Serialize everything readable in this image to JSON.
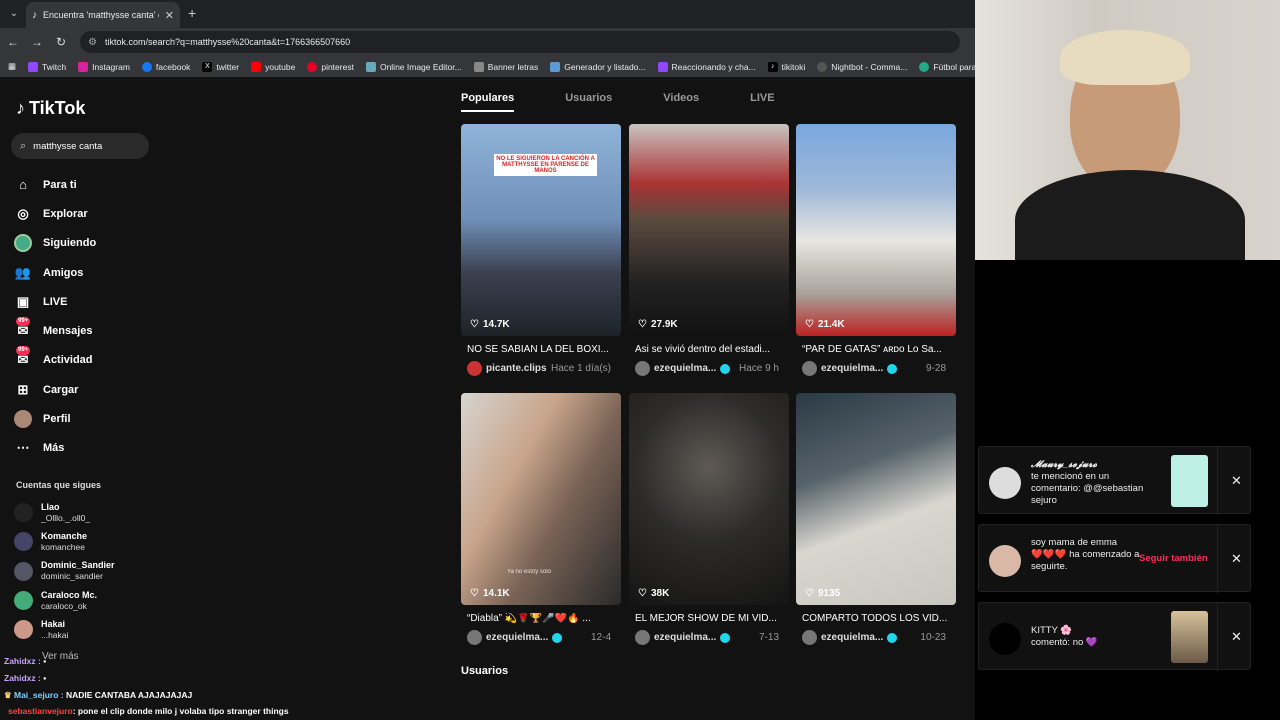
{
  "browser": {
    "tab_title": "Encuentra 'matthysse canta' en",
    "url": "tiktok.com/search?q=matthysse%20canta&t=1766366507660",
    "bookmarks": [
      "Twitch",
      "Instagram",
      "facebook",
      "twitter",
      "youtube",
      "pinterest",
      "Online Image Editor...",
      "Banner letras",
      "Generador y listado...",
      "Reaccionando y cha...",
      "tikitoki",
      "Nightbot - Comma...",
      "Fútbol para Todos"
    ]
  },
  "sidebar": {
    "logo": "TikTok",
    "search_value": "matthysse canta",
    "menu": [
      {
        "label": "Para ti",
        "icon": "home-icon"
      },
      {
        "label": "Explorar",
        "icon": "compass-icon"
      },
      {
        "label": "Siguiendo",
        "icon": "following-icon"
      },
      {
        "label": "Amigos",
        "icon": "friends-icon"
      },
      {
        "label": "LIVE",
        "icon": "live-icon"
      },
      {
        "label": "Mensajes",
        "icon": "messages-icon",
        "badge": "99+"
      },
      {
        "label": "Actividad",
        "icon": "activity-icon",
        "badge": "99+"
      },
      {
        "label": "Cargar",
        "icon": "upload-icon"
      },
      {
        "label": "Perfil",
        "icon": "profile-icon"
      },
      {
        "label": "Más",
        "icon": "more-icon"
      }
    ],
    "following_title": "Cuentas que sigues",
    "following": [
      {
        "name": "Llao",
        "handle": "_Olllo._.oll0_"
      },
      {
        "name": "Komanche",
        "handle": "komanchee"
      },
      {
        "name": "Dominic_Sandier",
        "handle": "dominic_sandier"
      },
      {
        "name": "Caraloco Mc.",
        "handle": "caraloco_ok"
      },
      {
        "name": "Hakai",
        "handle": "...hakai"
      }
    ],
    "see_more": "Ver más"
  },
  "chat": [
    {
      "user": "Zahidxz :",
      "msg": ""
    },
    {
      "user": "Zahidxz :",
      "msg": ""
    },
    {
      "user": "Mai_sejuro :",
      "msg": "NADIE CANTABA AJAJAJAJAJ"
    },
    {
      "user": "sebastianvejuro",
      "msg": ": pone el clip donde milo j volaba tipo stranger things"
    }
  ],
  "results": {
    "tabs": [
      "Populares",
      "Usuarios",
      "Videos",
      "LIVE"
    ],
    "videos": [
      {
        "likes": "14.7K",
        "title": "NO SE SABIAN LA DEL BOXI...",
        "user": "picante.clips",
        "date": "Hace 1 día(s)",
        "verified": false,
        "overlay": "NO LE SIGUIERON LA CANCIÓN A MATTHYSSE EN PARENSE DE MANOS"
      },
      {
        "likes": "27.9K",
        "title": "Asi se vivió dentro del estadi...",
        "user": "ezequielma...",
        "date": "Hace 9 h",
        "verified": true,
        "overlay": ""
      },
      {
        "likes": "21.4K",
        "title": "“PAR DE GATAS” ᴀʀᴅᴏ Lo Sa...",
        "user": "ezequielma...",
        "date": "9-28",
        "verified": true,
        "overlay": ""
      },
      {
        "likes": "14.1K",
        "title": "“Diabla” 💫🌹🏆🎤❤️🔥 ...",
        "user": "ezequielma...",
        "date": "12-4",
        "verified": true,
        "overlay": "Ya no estoy solo"
      },
      {
        "likes": "38K",
        "title": "EL MEJOR SHOW DE MI VID...",
        "user": "ezequielma...",
        "date": "7-13",
        "verified": true,
        "overlay": ""
      },
      {
        "likes": "9135",
        "title": "COMPARTO TODOS LOS VID...",
        "user": "ezequielma...",
        "date": "10-23",
        "verified": true,
        "overlay": ""
      }
    ],
    "users_heading": "Usuarios"
  },
  "notifications": [
    {
      "name": "𝓜𝓪𝓾𝓻𝔂_𝓼𝓮𝓳𝓾𝓻𝓸",
      "text": "te mencionó en un comentario: @@sebastian sejuro",
      "action": ""
    },
    {
      "name": "soy mama de emma",
      "text": "❤️❤️❤️ ha comenzado a seguirte.",
      "action": "Seguir también"
    },
    {
      "name": "KITTY 🌸",
      "text": "comentó: no 💜",
      "action": ""
    }
  ],
  "colors": {
    "accent": "#fe2c55",
    "verified": "#20d5ec",
    "bg": "#121212"
  }
}
